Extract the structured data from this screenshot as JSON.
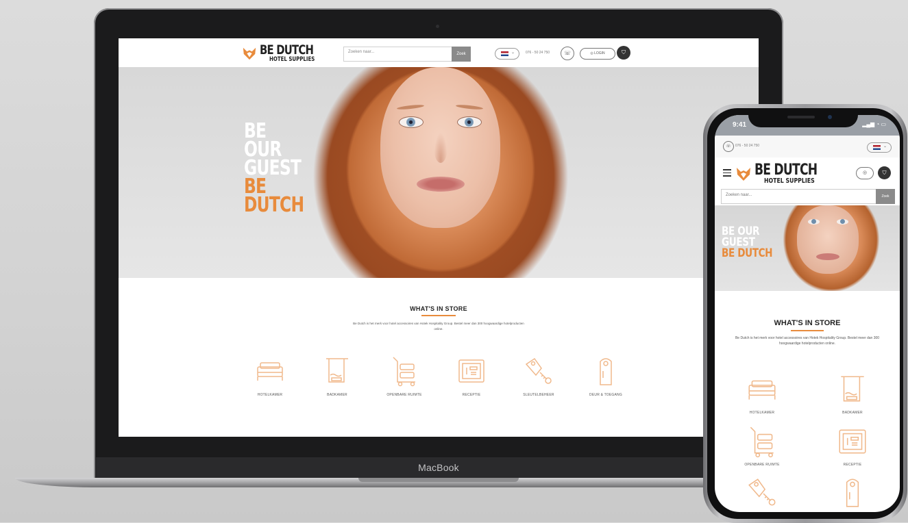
{
  "device": {
    "laptop_label": "MacBook"
  },
  "desktop": {
    "logo": {
      "main": "BE DUTCH",
      "sub": "HOTEL SUPPLIES"
    },
    "search": {
      "placeholder": "Zoeken naar...",
      "button": "Zoek"
    },
    "phone_number": "076 - 50 24 750",
    "login_label": "LOGIN",
    "hero": {
      "line1": "BE",
      "line2": "OUR",
      "line3": "GUEST",
      "line4": "BE",
      "line5": "DUTCH"
    },
    "store": {
      "title": "WHAT'S IN STORE",
      "description": "Be Dutch is het merk voor hotel accessoires van Hotek Hospitality Group. Bestel meer dan 300 hoogwaardige hotelproducten online.",
      "categories": [
        {
          "label": "HOTELKAMER",
          "icon": "bed-icon"
        },
        {
          "label": "BADKAMER",
          "icon": "towel-rack-icon"
        },
        {
          "label": "OPENBARE RUIMTE",
          "icon": "luggage-cart-icon"
        },
        {
          "label": "RECEPTIE",
          "icon": "safe-icon"
        },
        {
          "label": "SLEUTELBEHEER",
          "icon": "keys-icon"
        },
        {
          "label": "DEUR & TOEGANG",
          "icon": "door-hanger-icon"
        }
      ]
    }
  },
  "mobile": {
    "status_time": "9:41",
    "phone_number": "076 - 50 24 750",
    "logo": {
      "main": "BE DUTCH",
      "sub": "HOTEL SUPPLIES"
    },
    "search": {
      "placeholder": "Zoeken naar...",
      "button": "Zoek"
    },
    "hero": {
      "line1": "BE OUR",
      "line2": "GUEST",
      "line3": "BE DUTCH"
    },
    "store": {
      "title": "WHAT'S IN STORE",
      "description": "Be Dutch is het merk voor hotel accessoires van Hotek Hospitality Group. Bestel meer dan 300 hoogwaardige hotelproducten online.",
      "categories": [
        {
          "label": "HOTELKAMER",
          "icon": "bed-icon"
        },
        {
          "label": "BADKAMER",
          "icon": "towel-rack-icon"
        },
        {
          "label": "OPENBARE RUIMTE",
          "icon": "luggage-cart-icon"
        },
        {
          "label": "RECEPTIE",
          "icon": "safe-icon"
        },
        {
          "label": "",
          "icon": "keys-icon"
        },
        {
          "label": "",
          "icon": "door-hanger-icon"
        }
      ]
    }
  },
  "colors": {
    "accent": "#e88b3c",
    "dark": "#222222",
    "icon_stroke": "#f0b98c"
  }
}
